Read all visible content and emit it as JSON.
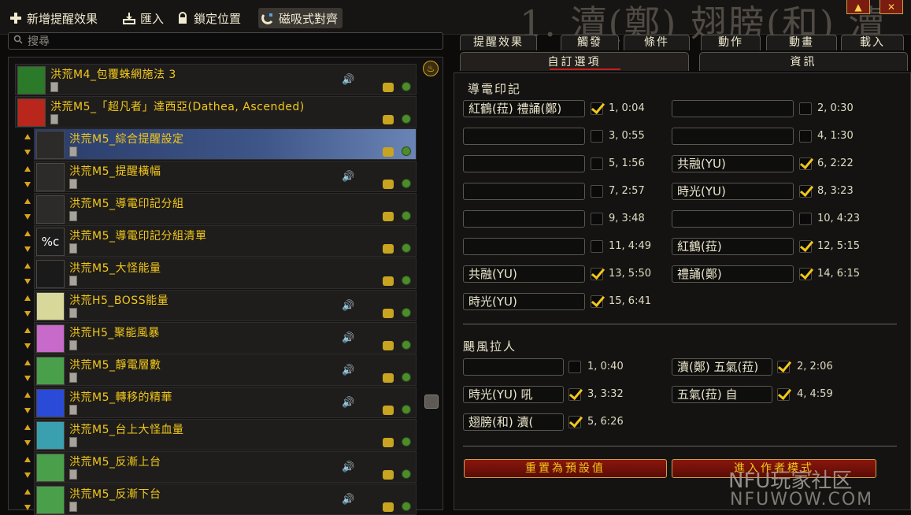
{
  "toolbar": {
    "new_aura": "新增提醒效果",
    "import": "匯入",
    "lock_position": "鎖定位置",
    "magnetic_align": "磁吸式對齊"
  },
  "background_title": "1. 瀆(鄭) 翅膀(和) 瀆",
  "search": {
    "placeholder": "搜尋"
  },
  "auras": [
    {
      "name": "洪荒M4_包覆蛛網施法 3",
      "sound": true,
      "child": false,
      "selected": false,
      "thumb_color": "#2a7a2a"
    },
    {
      "name": "洪荒M5_「超凡者」達西亞(Dathea, Ascended)",
      "sound": false,
      "child": false,
      "selected": false,
      "thumb_color": "#b8261c"
    },
    {
      "name": "洪荒M5_綜合提醒設定",
      "sound": false,
      "child": true,
      "selected": true,
      "thumb_color": "#2c2b29"
    },
    {
      "name": "洪荒M5_提醒橫幅",
      "sound": true,
      "child": true,
      "selected": false,
      "thumb_color": "#2c2b29"
    },
    {
      "name": "洪荒M5_導電印記分組",
      "sound": false,
      "child": true,
      "selected": false,
      "thumb_color": "#2c2b29"
    },
    {
      "name": "洪荒M5_導電印記分組清單",
      "sound": false,
      "child": true,
      "selected": false,
      "thumb_color": "#1c1c1c",
      "thumb_text": "%c"
    },
    {
      "name": "洪荒M5_大怪能量",
      "sound": false,
      "child": true,
      "selected": false,
      "thumb_color": "#1a1a1a"
    },
    {
      "name": "洪荒H5_BOSS能量",
      "sound": true,
      "child": true,
      "selected": false,
      "thumb_color": "#d8d89a"
    },
    {
      "name": "洪荒H5_聚能風暴",
      "sound": true,
      "child": true,
      "selected": false,
      "thumb_color": "#c76ac9"
    },
    {
      "name": "洪荒M5_靜電層數",
      "sound": true,
      "child": true,
      "selected": false,
      "thumb_color": "#4aa04a"
    },
    {
      "name": "洪荒M5_轉移的精華",
      "sound": true,
      "child": true,
      "selected": false,
      "thumb_color": "#2a4ad8"
    },
    {
      "name": "洪荒M5_台上大怪血量",
      "sound": false,
      "child": true,
      "selected": false,
      "thumb_color": "#3aa0b0"
    },
    {
      "name": "洪荒M5_反漸上台",
      "sound": true,
      "child": true,
      "selected": false,
      "thumb_color": "#4aa04a"
    },
    {
      "name": "洪荒M5_反漸下台",
      "sound": true,
      "child": true,
      "selected": false,
      "thumb_color": "#4aa04a"
    }
  ],
  "tabs_row1": [
    "提醒效果",
    "觸發",
    "條件",
    "動作",
    "動畫",
    "載入"
  ],
  "tabs_row2": [
    "自訂選項",
    "資訊"
  ],
  "section1": {
    "title": "導電印記",
    "entries": [
      {
        "value": "紅鶴(菈) 禮誦(鄭)",
        "checked": true,
        "label": "1, 0:04"
      },
      {
        "value": "",
        "checked": false,
        "label": "2, 0:30"
      },
      {
        "value": "",
        "checked": false,
        "label": "3, 0:55"
      },
      {
        "value": "",
        "checked": false,
        "label": "4, 1:30"
      },
      {
        "value": "",
        "checked": false,
        "label": "5, 1:56"
      },
      {
        "value": "共融(YU)",
        "checked": true,
        "label": "6, 2:22"
      },
      {
        "value": "",
        "checked": false,
        "label": "7, 2:57"
      },
      {
        "value": "時光(YU)",
        "checked": true,
        "label": "8, 3:23"
      },
      {
        "value": "",
        "checked": false,
        "label": "9, 3:48"
      },
      {
        "value": "",
        "checked": false,
        "label": "10, 4:23"
      },
      {
        "value": "",
        "checked": false,
        "label": "11, 4:49"
      },
      {
        "value": "紅鶴(菈)",
        "checked": true,
        "label": "12, 5:15"
      },
      {
        "value": "共融(YU)",
        "checked": true,
        "label": "13, 5:50"
      },
      {
        "value": "禮誦(鄭)",
        "checked": true,
        "label": "14, 6:15"
      },
      {
        "value": "時光(YU)",
        "checked": true,
        "label": "15, 6:41"
      }
    ]
  },
  "section2": {
    "title": "颶風拉人",
    "entries": [
      {
        "value": "",
        "checked": false,
        "label": "1, 0:40"
      },
      {
        "value": "瀆(鄭) 五氣(菈)",
        "checked": true,
        "label": "2, 2:06"
      },
      {
        "value": "時光(YU) 吼",
        "checked": true,
        "label": "3, 3:32"
      },
      {
        "value": "五氣(菈) 自",
        "checked": true,
        "label": "4, 4:59"
      },
      {
        "value": "翅膀(和) 瀆(",
        "checked": true,
        "label": "5, 6:26"
      }
    ]
  },
  "buttons": {
    "reset": "重置為預設值",
    "author_mode": "進入作者模式"
  },
  "watermark": {
    "line1": "NFU玩家社区",
    "line2": "NFUWOW.COM"
  }
}
